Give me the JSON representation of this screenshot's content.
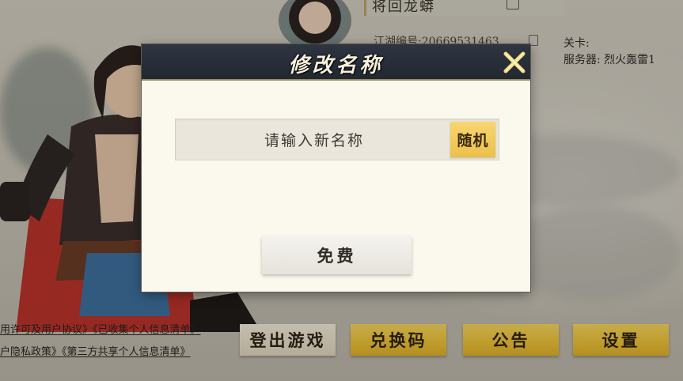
{
  "profile": {
    "name": "将回龙蟒",
    "uid_text": "江湖编号:20669531463",
    "level_label": "关卡:",
    "server_label": "服务器: 烈火轰雷1"
  },
  "agreements": {
    "line1": "用许可及用户协议》《已收集个人信息清单》",
    "line2": "户隐私政策》《第三方共享个人信息清单》"
  },
  "bottom_buttons": {
    "logout": "登出游戏",
    "redeem": "兑换码",
    "notice": "公告",
    "settings": "设置"
  },
  "dialog": {
    "title": "修改名称",
    "input_placeholder": "请输入新名称",
    "input_value": "",
    "random_label": "随机",
    "confirm_label": "免费"
  },
  "icons": {
    "close": "close-x-icon",
    "edit": "edit-icon",
    "copy": "copy-icon"
  },
  "colors": {
    "gold_button": "#eec04a",
    "dialog_header": "#222832",
    "dialog_body": "#fbf9ee"
  }
}
